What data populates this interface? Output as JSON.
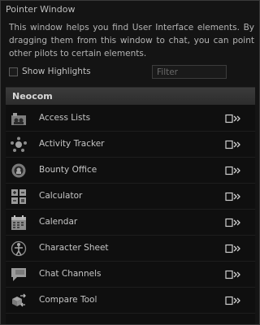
{
  "window": {
    "title": "Pointer Window",
    "description": "This window helps you find User Interface elements. By dragging them from this window to chat, you can point other pilots to certain elements.",
    "show_highlights_label": "Show Highlights",
    "show_highlights_checked": false,
    "filter_placeholder": "Filter",
    "filter_value": ""
  },
  "section": {
    "title": "Neocom",
    "items": [
      {
        "label": "Access Lists",
        "icon": "access-lists-icon"
      },
      {
        "label": "Activity Tracker",
        "icon": "activity-tracker-icon"
      },
      {
        "label": "Bounty Office",
        "icon": "bounty-office-icon"
      },
      {
        "label": "Calculator",
        "icon": "calculator-icon"
      },
      {
        "label": "Calendar",
        "icon": "calendar-icon"
      },
      {
        "label": "Character Sheet",
        "icon": "character-sheet-icon"
      },
      {
        "label": "Chat Channels",
        "icon": "chat-channels-icon"
      },
      {
        "label": "Compare Tool",
        "icon": "compare-tool-icon"
      }
    ]
  },
  "colors": {
    "background": "#141414",
    "panel": "#0f0f0f",
    "header": "#333333",
    "text": "#c6c6c6",
    "icon": "#9c9c9c"
  }
}
